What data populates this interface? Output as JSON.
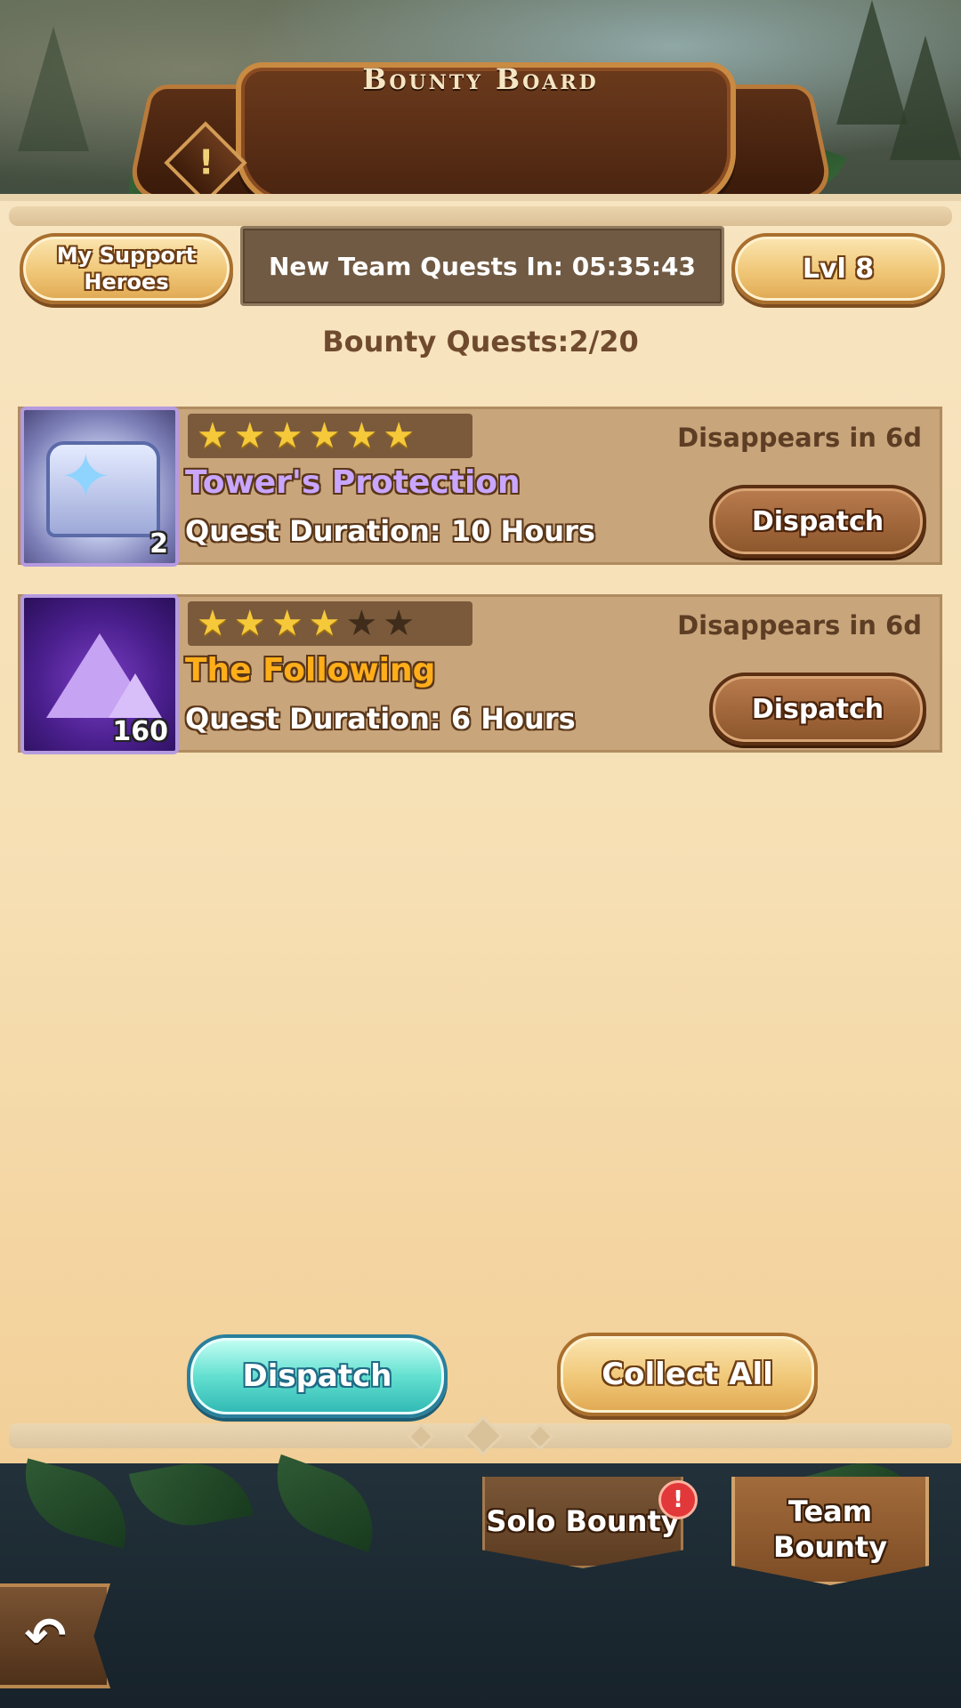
{
  "header": {
    "title": "Bounty Board",
    "info_glyph": "!"
  },
  "top_bar": {
    "support_label_line1": "My Support",
    "support_label_line2": "Heroes",
    "timer_text": "New Team Quests In: 05:35:43",
    "level_label": "Lvl 8"
  },
  "quest_count": "Bounty Quests:2/20",
  "quests": [
    {
      "name": "Tower's Protection",
      "name_color": "#c9a6ff",
      "icon": "crystal-chest-icon",
      "item_count": "2",
      "stars_filled": 6,
      "stars_total": 6,
      "expires": "Disappears in 6d",
      "duration": "Quest Duration: 10 Hours",
      "dispatch_label": "Dispatch"
    },
    {
      "name": "The Following",
      "name_color": "#ffae1a",
      "icon": "purple-ore-icon",
      "item_count": "160",
      "stars_filled": 4,
      "stars_total": 6,
      "expires": "Disappears in 6d",
      "duration": "Quest Duration: 6 Hours",
      "dispatch_label": "Dispatch"
    }
  ],
  "actions": {
    "dispatch_label": "Dispatch",
    "collect_all_label": "Collect All"
  },
  "tabs": {
    "solo_label": "Solo Bounty",
    "team_label_line1": "Team",
    "team_label_line2": "Bounty",
    "solo_badge": "!"
  },
  "back_icon": "back-arrow-icon"
}
